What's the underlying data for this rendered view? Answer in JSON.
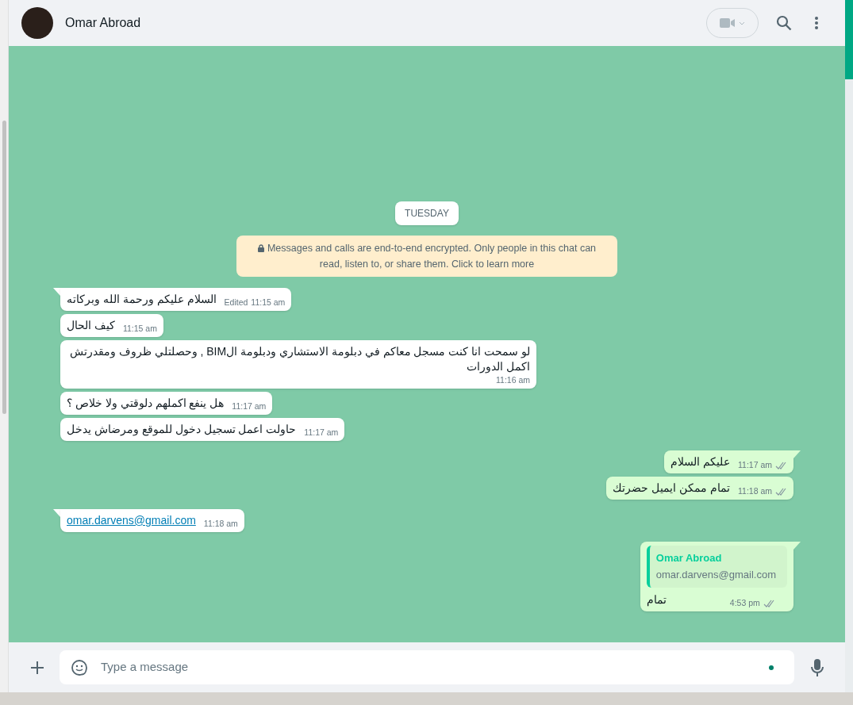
{
  "header": {
    "contact_name": "Omar Abroad"
  },
  "date_label": "TUESDAY",
  "encryption_notice": "Messages and calls are end-to-end encrypted. Only people in this chat can read, listen to, or share them. Click to learn more",
  "messages": [
    {
      "outgoing": false,
      "kind": "text",
      "tail": true,
      "text": "السلام عليكم ورحمة الله وبركاته",
      "edited": "Edited",
      "time": "11:15 am"
    },
    {
      "outgoing": false,
      "kind": "text",
      "tail": false,
      "text": "كيف الحال",
      "time": "11:15 am"
    },
    {
      "outgoing": false,
      "kind": "text",
      "tail": false,
      "text": "لو سمحت انا كنت مسجل معاكم في دبلومة الاستشاري ودبلومة الBIM , وحصلتلي ظروف ومقدرتش اكمل الدورات",
      "time": "11:16 am"
    },
    {
      "outgoing": false,
      "kind": "text",
      "tail": false,
      "text": "هل ينفع اكملهم دلوقتي ولا خلاص ؟",
      "time": "11:17 am"
    },
    {
      "outgoing": false,
      "kind": "text",
      "tail": false,
      "text": "حاولت اعمل تسجيل دخول للموقع ومرضاش يدخل",
      "time": "11:17 am"
    },
    {
      "outgoing": true,
      "kind": "text",
      "tail": true,
      "text": "عليكم السلام",
      "time": "11:17 am"
    },
    {
      "outgoing": true,
      "kind": "text",
      "tail": false,
      "text": "تمام ممكن ايميل حضرتك",
      "time": "11:18 am"
    },
    {
      "outgoing": false,
      "kind": "link",
      "tail": true,
      "text": "omar.darvens@gmail.com",
      "time": "11:18 am"
    },
    {
      "outgoing": true,
      "kind": "quote",
      "tail": true,
      "quote_author": "Omar Abroad",
      "quote_text": "omar.darvens@gmail.com",
      "text": "تمام",
      "time": "4:53 pm"
    }
  ],
  "composer": {
    "placeholder": "Type a message"
  }
}
